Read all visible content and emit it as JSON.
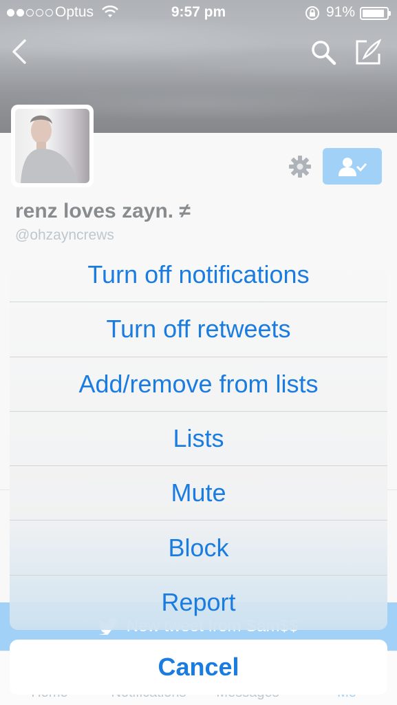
{
  "status_bar": {
    "carrier": "Optus",
    "time": "9:57 pm",
    "battery_percent": "91%",
    "battery_level": 0.91,
    "signal_bars": 2
  },
  "profile": {
    "display_name": "renz loves zayn. ≠",
    "handle": "@ohzayncrews"
  },
  "background": {
    "new_tweet_banner": "New tweet from Sam$$",
    "tabs": [
      "Home",
      "Notifications",
      "Messages",
      "Me"
    ]
  },
  "action_sheet": {
    "items": [
      {
        "label": "Turn off notifications"
      },
      {
        "label": "Turn off retweets"
      },
      {
        "label": "Add/remove from lists"
      },
      {
        "label": "Lists"
      },
      {
        "label": "Mute"
      },
      {
        "label": "Block"
      },
      {
        "label": "Report"
      }
    ],
    "cancel_label": "Cancel"
  },
  "colors": {
    "accent": "#1a7ce0",
    "twitter_blue": "#55acee"
  },
  "icons": [
    "back-chevron-icon",
    "search-icon",
    "compose-icon",
    "gear-icon",
    "following-user-icon",
    "wifi-icon",
    "rotation-lock-icon",
    "bird-icon"
  ]
}
